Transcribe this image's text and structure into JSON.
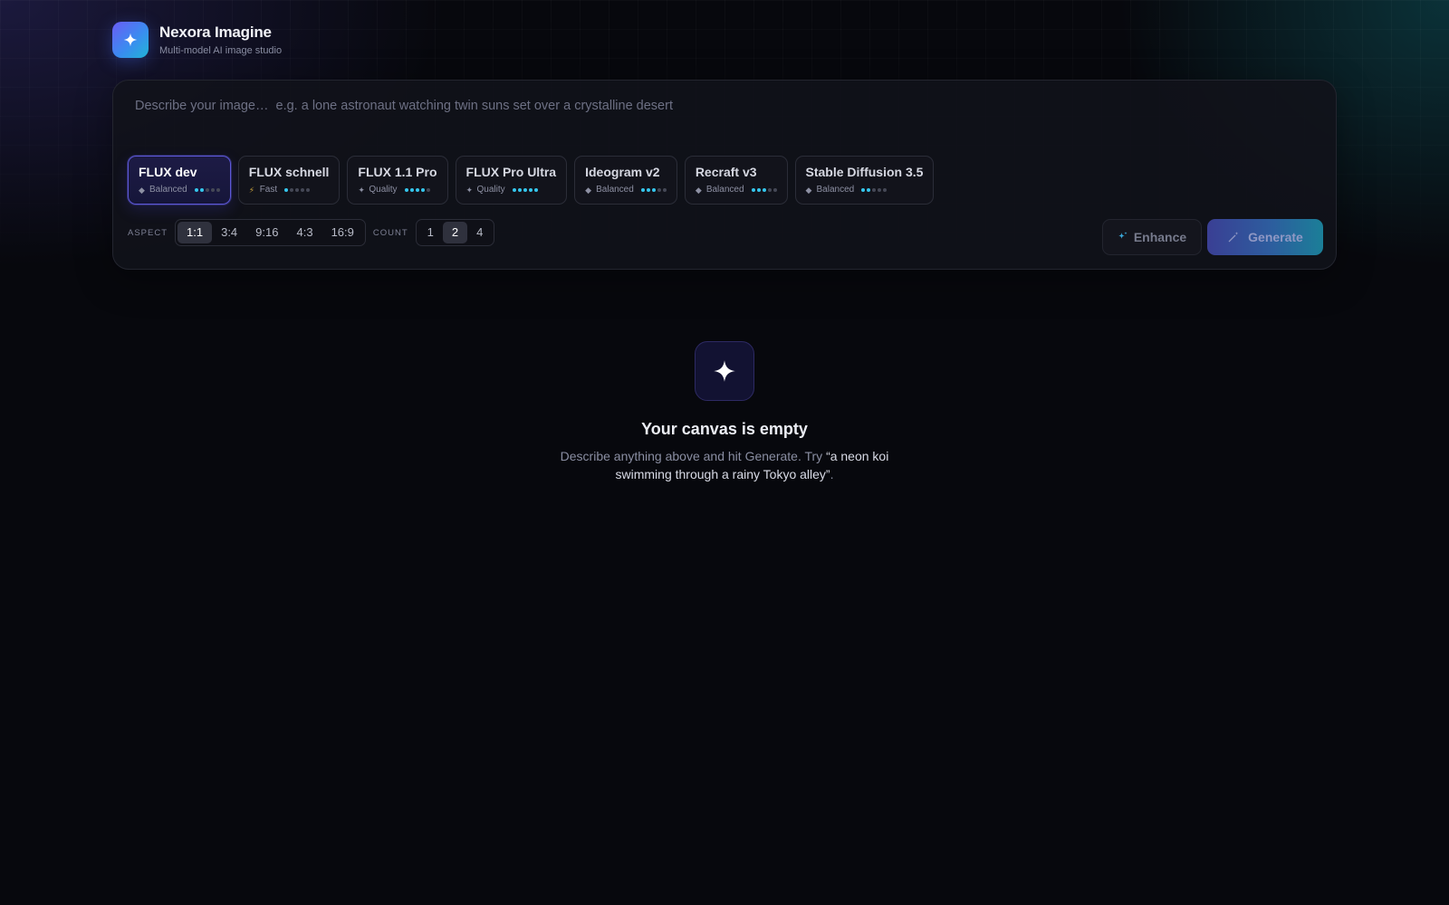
{
  "app": {
    "name": "Nexora Imagine",
    "subtitle": "Multi-model AI image studio",
    "logo_icon": "sparkle-icon"
  },
  "composer": {
    "prompt_value": "",
    "prompt_placeholder": "Describe your image…  e.g. a lone astronaut watching twin suns set over a crystalline desert",
    "models": [
      {
        "name": "FLUX dev",
        "tier": "Balanced",
        "tier_icon": "diamond-icon",
        "rating": 2,
        "max": 5,
        "selected": true
      },
      {
        "name": "FLUX schnell",
        "tier": "Fast",
        "tier_icon": "bolt-icon",
        "rating": 1,
        "max": 5,
        "selected": false
      },
      {
        "name": "FLUX 1.1 Pro",
        "tier": "Quality",
        "tier_icon": "sparkle-icon",
        "rating": 4,
        "max": 5,
        "selected": false
      },
      {
        "name": "FLUX Pro Ultra",
        "tier": "Quality",
        "tier_icon": "sparkle-icon",
        "rating": 5,
        "max": 5,
        "selected": false
      },
      {
        "name": "Ideogram v2",
        "tier": "Balanced",
        "tier_icon": "diamond-icon",
        "rating": 3,
        "max": 5,
        "selected": false
      },
      {
        "name": "Recraft v3",
        "tier": "Balanced",
        "tier_icon": "diamond-icon",
        "rating": 3,
        "max": 5,
        "selected": false
      },
      {
        "name": "Stable Diffusion 3.5",
        "tier": "Balanced",
        "tier_icon": "diamond-icon",
        "rating": 2,
        "max": 5,
        "selected": false
      }
    ],
    "aspect": {
      "label": "ASPECT",
      "options": [
        "1:1",
        "3:4",
        "9:16",
        "4:3",
        "16:9"
      ],
      "selected": "1:1"
    },
    "count": {
      "label": "COUNT",
      "options": [
        "1",
        "2",
        "4"
      ],
      "selected": "2"
    },
    "enhance_label": "Enhance",
    "generate_label": "Generate"
  },
  "empty_state": {
    "icon": "sparkle-icon",
    "title": "Your canvas is empty",
    "description_prefix": "Describe anything above and hit Generate. Try ",
    "example": "“a neon koi swimming through a rainy Tokyo alley”",
    "description_suffix": "."
  },
  "colors": {
    "accent_cyan": "#35c6ec",
    "accent_indigo": "#5d58d8",
    "background": "#07080d"
  }
}
